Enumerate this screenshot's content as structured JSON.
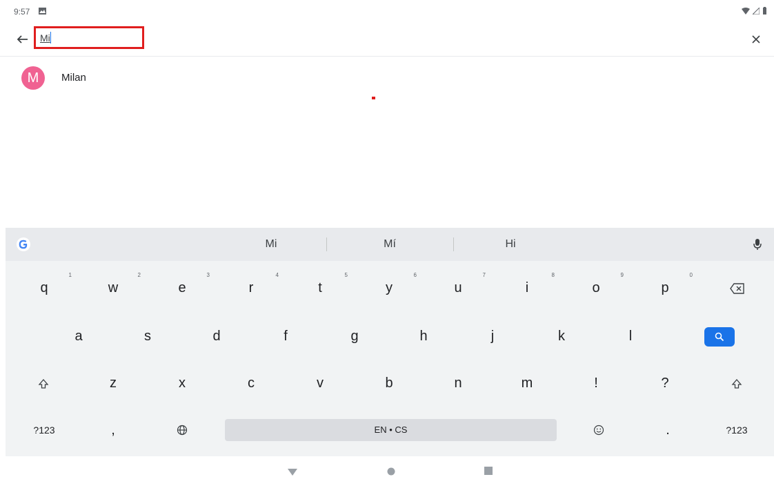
{
  "status": {
    "time": "9:57"
  },
  "search": {
    "value": "Mi",
    "placeholder": ""
  },
  "results": [
    {
      "initial": "M",
      "name": "Milan"
    }
  ],
  "keyboard": {
    "suggestions": [
      "Mi",
      "Mí",
      "Hi"
    ],
    "row1": [
      {
        "k": "q",
        "h": "1"
      },
      {
        "k": "w",
        "h": "2"
      },
      {
        "k": "e",
        "h": "3"
      },
      {
        "k": "r",
        "h": "4"
      },
      {
        "k": "t",
        "h": "5"
      },
      {
        "k": "y",
        "h": "6"
      },
      {
        "k": "u",
        "h": "7"
      },
      {
        "k": "i",
        "h": "8"
      },
      {
        "k": "o",
        "h": "9"
      },
      {
        "k": "p",
        "h": "0"
      }
    ],
    "row2": [
      "a",
      "s",
      "d",
      "f",
      "g",
      "h",
      "j",
      "k",
      "l"
    ],
    "row3": [
      "z",
      "x",
      "c",
      "v",
      "b",
      "n",
      "m",
      "!",
      "?"
    ],
    "row4": {
      "symbols_left": "?123",
      "comma": ",",
      "space_label": "EN • CS",
      "period": ".",
      "symbols_right": "?123"
    }
  },
  "colors": {
    "accent": "#1a73e8",
    "avatar": "#f06292",
    "highlight": "#e01e1e"
  }
}
